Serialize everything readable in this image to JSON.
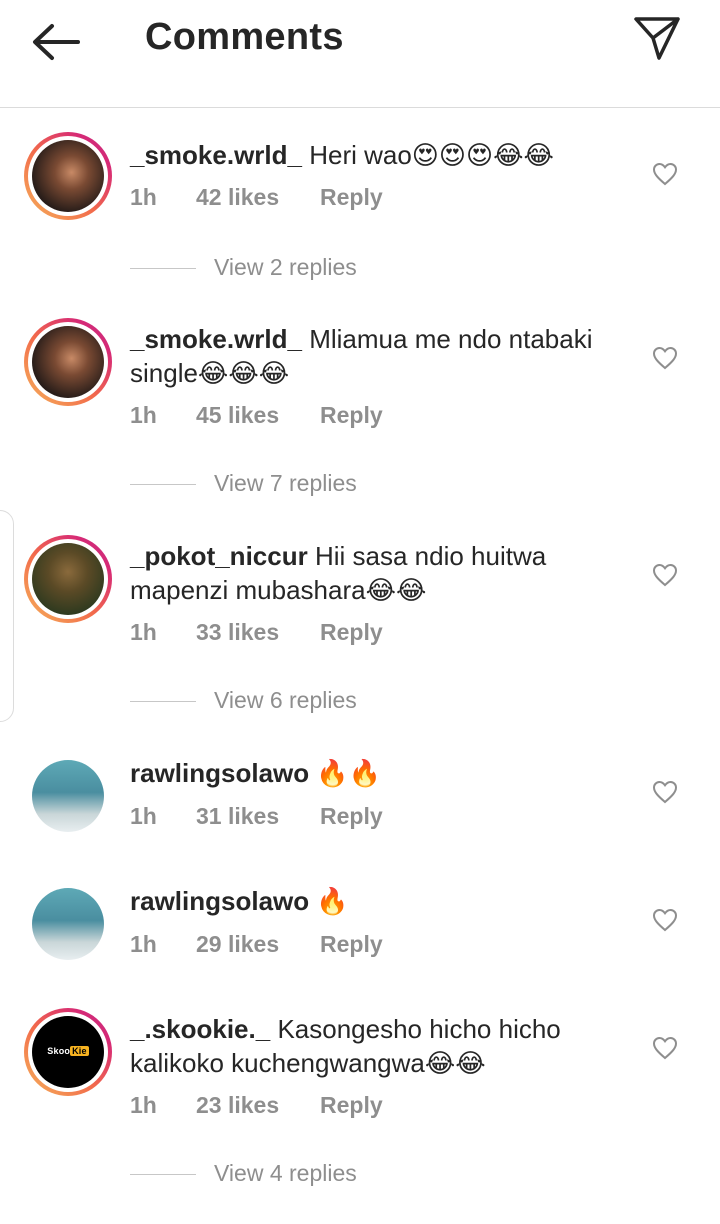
{
  "header": {
    "title": "Comments",
    "back_icon": "arrow-left-icon",
    "send_icon": "send-icon"
  },
  "comments": [
    {
      "username": "_smoke.wrld_",
      "text": "Heri wao😍😍😍😂😂",
      "time": "1h",
      "likes": "42 likes",
      "reply": "Reply",
      "view_replies": "View 2 replies"
    },
    {
      "username": "_smoke.wrld_",
      "text": "Mliamua me ndo ntabaki single😂😂😂",
      "time": "1h",
      "likes": "45 likes",
      "reply": "Reply",
      "view_replies": "View 7 replies"
    },
    {
      "username": "_pokot_niccur",
      "text": "Hii sasa ndio huitwa mapenzi mubashara😂😂",
      "time": "1h",
      "likes": "33 likes",
      "reply": "Reply",
      "view_replies": "View 6 replies"
    },
    {
      "username": "rawlingsolawo",
      "text": "🔥🔥",
      "time": "1h",
      "likes": "31 likes",
      "reply": "Reply"
    },
    {
      "username": "rawlingsolawo",
      "text": "🔥",
      "time": "1h",
      "likes": "29 likes",
      "reply": "Reply"
    },
    {
      "username": "_.skookie._",
      "text": "Kasongesho hicho hicho kalikoko kuchengwangwa😂😂",
      "time": "1h",
      "likes": "23 likes",
      "reply": "Reply",
      "view_replies": "View 4 replies",
      "avatar_logo": "Skoo Kie"
    }
  ]
}
